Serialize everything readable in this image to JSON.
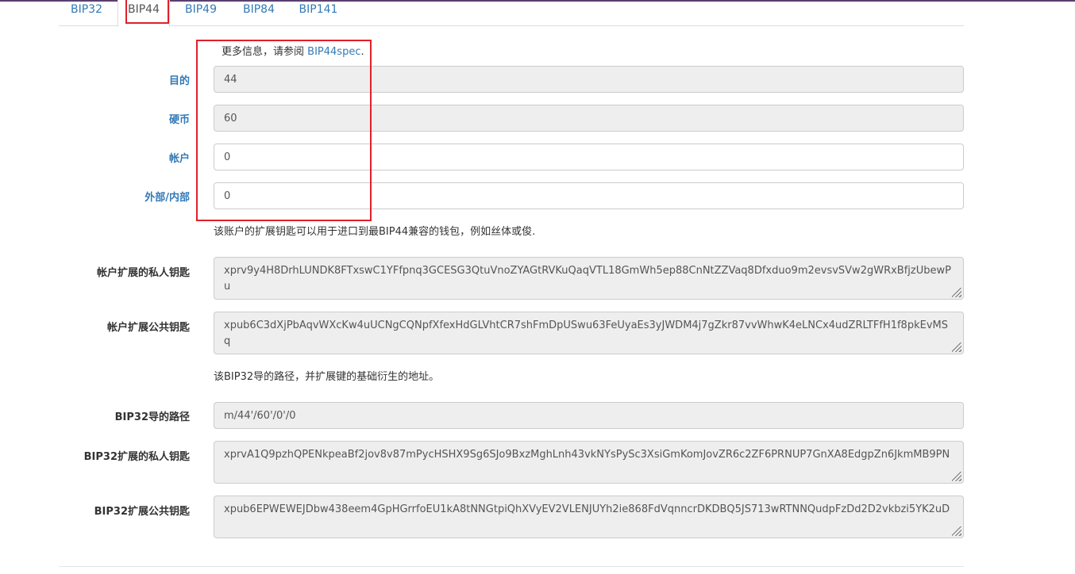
{
  "tabs": [
    {
      "label": "BIP32"
    },
    {
      "label": "BIP44"
    },
    {
      "label": "BIP49"
    },
    {
      "label": "BIP84"
    },
    {
      "label": "BIP141"
    }
  ],
  "info": {
    "prefix": "更多信息，请参阅",
    "link": "BIP44spec",
    "suffix": "."
  },
  "fields": {
    "purpose": {
      "label": "目的",
      "value": "44"
    },
    "coin": {
      "label": "硬币",
      "value": "60"
    },
    "account": {
      "label": "帐户",
      "value": "0"
    },
    "change": {
      "label": "外部/内部",
      "value": "0"
    }
  },
  "account_help": "该账户的扩展钥匙可以用于进口到最BIP44兼容的钱包，例如丝体或俊.",
  "account_xprv": {
    "label": "帐户扩展的私人钥匙",
    "value": "xprv9y4H8DrhLUNDK8FTxswC1YFfpnq3GCESG3QtuVnoZYAGtRVKuQaqVTL18GmWh5ep88CnNtZZVaq8Dfxduo9m2evsvSVw2gWRxBfjzUbewPu"
  },
  "account_xpub": {
    "label": "帐户扩展公共钥匙",
    "value": "xpub6C3dXjPbAqvWXcKw4uUCNgCQNpfXfexHdGLVhtCR7shFmDpUSwu63FeUyaEs3yJWDM4j7gZkr87vvWhwK4eLNCx4udZRLTFfH1f8pkEvMSq"
  },
  "bip32_help": "该BIP32导的路径，并扩展键的基础衍生的地址。",
  "bip32_path": {
    "label": "BIP32导的路径",
    "value": "m/44'/60'/0'/0"
  },
  "bip32_xprv": {
    "label": "BIP32扩展的私人钥匙",
    "value": "xprvA1Q9pzhQPENkpeaBf2jov8v87mPycHSHX9Sg6SJo9BxzMghLnh43vkNYsPySc3XsiGmKomJovZR6c2ZF6PRNUP7GnXA8EdgpZn6JkmMB9PN"
  },
  "bip32_xpub": {
    "label": "BIP32扩展公共钥匙",
    "value": "xpub6EPWEWEJDbw438eem4GpHGrrfoEU1kA8tNNGtpiQhXVyEV2VLENJUYh2ie868FdVqnncrDKDBQ5JS713wRTNNQudpFzDd2D2vkbzi5YK2uD"
  }
}
